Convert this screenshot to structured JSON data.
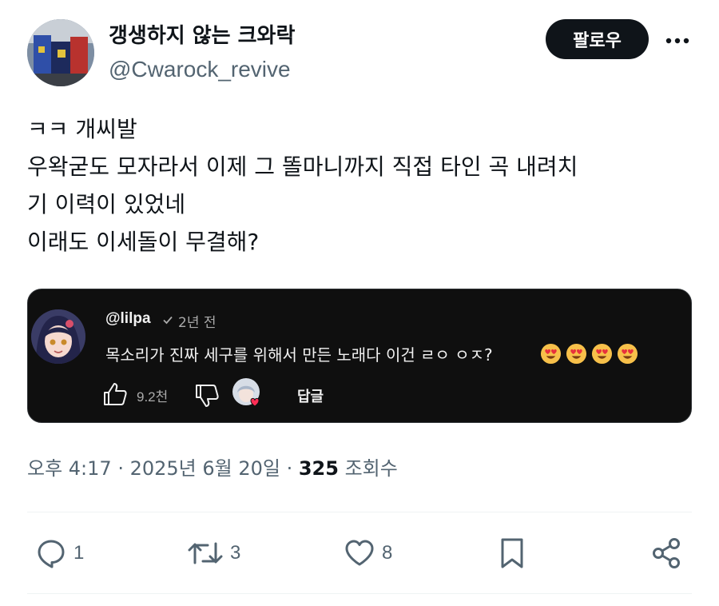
{
  "author": {
    "display_name": "갱생하지 않는 크와락",
    "handle": "@Cwarock_revive"
  },
  "header": {
    "follow_label": "팔로우",
    "more_icon": "more-horizontal-icon"
  },
  "tweet": {
    "lines": [
      "ㅋㅋ 개씨발",
      "우왁굳도 모자라서 이제 그 똘마니까지 직접 타인 곡 내려치",
      "기 이력이 있었네",
      "이래도 이세돌이 무결해?"
    ]
  },
  "embedded_comment": {
    "username": "@lilpa",
    "time": "2년 전",
    "text": "목소리가 진짜 세구를 위해서 만든 노래다 이건 ㄹㅇ ㅇㅈ?",
    "emojis": [
      "heart-eyes-emoji",
      "heart-eyes-emoji",
      "heart-eyes-emoji",
      "heart-eyes-emoji"
    ],
    "like_count": "9.2천",
    "reply_label": "답글"
  },
  "meta": {
    "time": "오후 4:17",
    "separator": " · ",
    "date": "2025년 6월 20일",
    "views_count": "325",
    "views_label": " 조회수"
  },
  "actions": {
    "replies": "1",
    "retweets": "3",
    "likes": "8"
  },
  "colors": {
    "text": "#0f1419",
    "secondary": "#536471",
    "card_bg": "#0f0f0f",
    "button_bg": "#0f1419"
  }
}
